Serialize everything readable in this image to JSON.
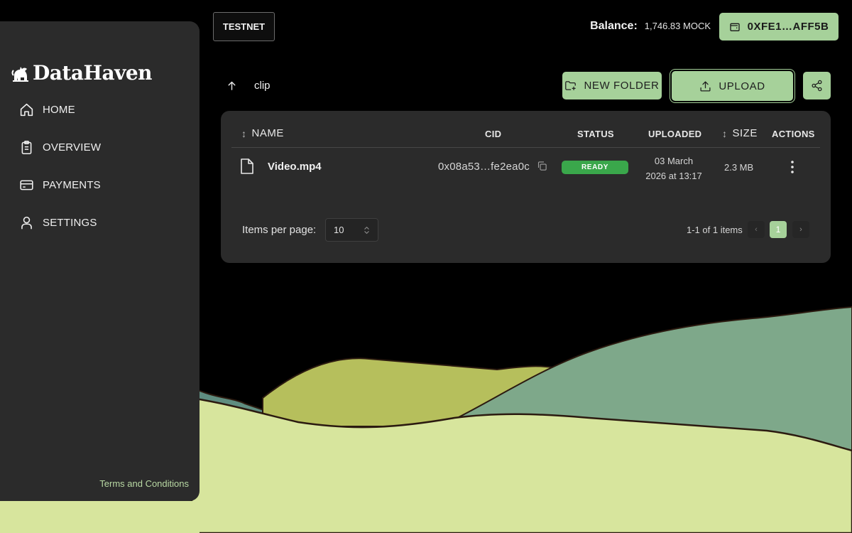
{
  "sidebar": {
    "logo": {
      "text": "DataHaven",
      "icon": "elephant-logo-icon"
    },
    "items": [
      {
        "label": "HOME",
        "icon": "home-icon"
      },
      {
        "label": "OVERVIEW",
        "icon": "clipboard-icon"
      },
      {
        "label": "PAYMENTS",
        "icon": "credit-card-icon"
      },
      {
        "label": "SETTINGS",
        "icon": "user-icon"
      }
    ],
    "footer_link": "Terms and Conditions"
  },
  "header": {
    "network_label": "TESTNET",
    "balance_label": "Balance:",
    "balance_value": "1,746.83 MOCK",
    "wallet_address": "0XFE1…AFF5B"
  },
  "toolbar": {
    "current_folder": "clip",
    "new_folder_label": "NEW FOLDER",
    "upload_label": "UPLOAD"
  },
  "table": {
    "columns": {
      "name": "NAME",
      "cid": "CID",
      "status": "STATUS",
      "uploaded": "UPLOADED",
      "size": "SIZE",
      "actions": "ACTIONS"
    },
    "rows": [
      {
        "name": "Video.mp4",
        "cid": "0x08a53…fe2ea0c",
        "status": "READY",
        "uploaded_line1": "03 March",
        "uploaded_line2": "2026 at 13:17",
        "size": "2.3 MB"
      }
    ]
  },
  "pagination": {
    "items_per_page_label": "Items per page:",
    "items_per_page_value": "10",
    "range_text": "1-1 of 1 items",
    "current_page": "1"
  },
  "colors": {
    "accent": "#a6d19a",
    "status_ready": "#3aa74b",
    "panel": "#2b2b2b",
    "background": "#000000"
  }
}
